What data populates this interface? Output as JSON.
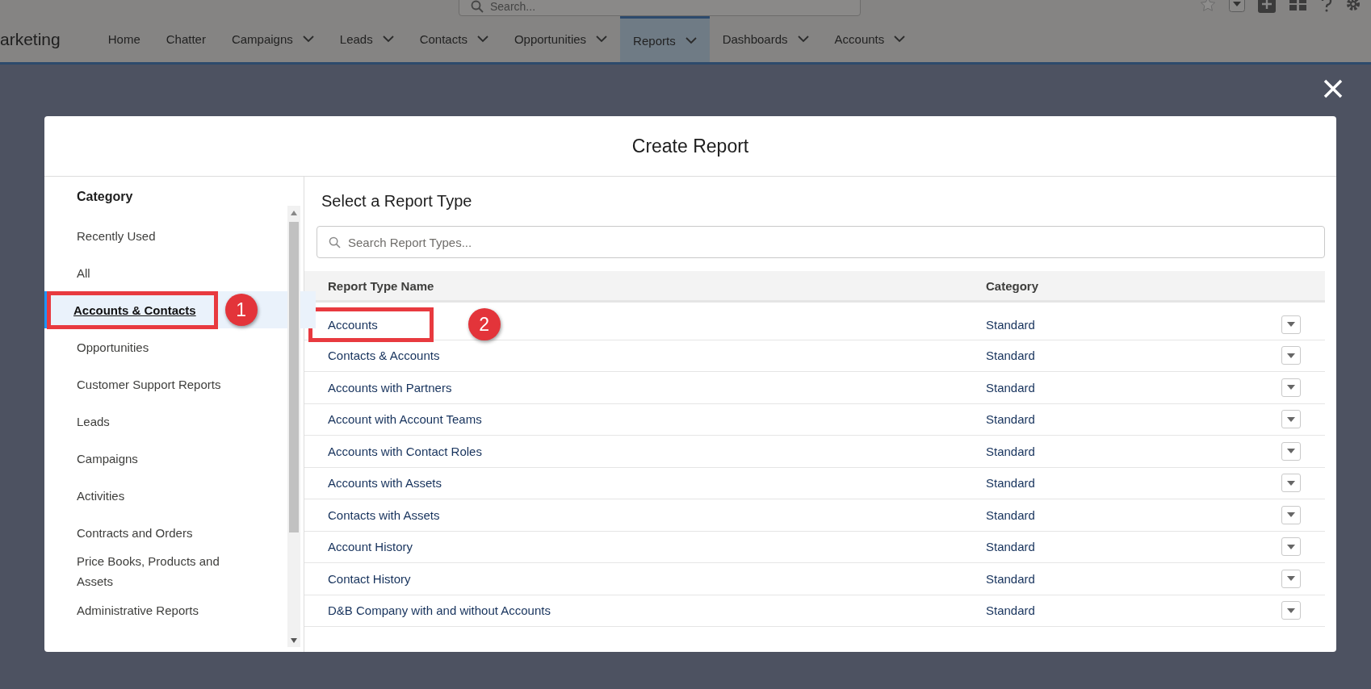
{
  "app": {
    "name": "arketing",
    "search_placeholder": "Search..."
  },
  "nav": [
    {
      "label": "Home",
      "has_menu": false,
      "selected": false
    },
    {
      "label": "Chatter",
      "has_menu": false,
      "selected": false
    },
    {
      "label": "Campaigns",
      "has_menu": true,
      "selected": false
    },
    {
      "label": "Leads",
      "has_menu": true,
      "selected": false
    },
    {
      "label": "Contacts",
      "has_menu": true,
      "selected": false
    },
    {
      "label": "Opportunities",
      "has_menu": true,
      "selected": false
    },
    {
      "label": "Reports",
      "has_menu": true,
      "selected": true
    },
    {
      "label": "Dashboards",
      "has_menu": true,
      "selected": false
    },
    {
      "label": "Accounts",
      "has_menu": true,
      "selected": false
    }
  ],
  "modal": {
    "title": "Create Report",
    "sidebar": {
      "heading": "Category",
      "items": [
        {
          "label": "Recently Used",
          "selected": false
        },
        {
          "label": "All",
          "selected": false
        },
        {
          "label": "Accounts & Contacts",
          "selected": true,
          "callout": "1"
        },
        {
          "label": "Opportunities",
          "selected": false
        },
        {
          "label": "Customer Support Reports",
          "selected": false
        },
        {
          "label": "Leads",
          "selected": false
        },
        {
          "label": "Campaigns",
          "selected": false
        },
        {
          "label": "Activities",
          "selected": false
        },
        {
          "label": "Contracts and Orders",
          "selected": false
        },
        {
          "label": "Price Books, Products and Assets",
          "selected": false
        },
        {
          "label": "Administrative Reports",
          "selected": false
        }
      ]
    },
    "main": {
      "heading": "Select a Report Type",
      "search_placeholder": "Search Report Types...",
      "columns": [
        "Report Type Name",
        "Category"
      ],
      "rows": [
        {
          "name": "Accounts",
          "category": "Standard",
          "callout": "2"
        },
        {
          "name": "Contacts & Accounts",
          "category": "Standard"
        },
        {
          "name": "Accounts with Partners",
          "category": "Standard"
        },
        {
          "name": "Account with Account Teams",
          "category": "Standard"
        },
        {
          "name": "Accounts with Contact Roles",
          "category": "Standard"
        },
        {
          "name": "Accounts with Assets",
          "category": "Standard"
        },
        {
          "name": "Contacts with Assets",
          "category": "Standard"
        },
        {
          "name": "Account History",
          "category": "Standard"
        },
        {
          "name": "Contact History",
          "category": "Standard"
        },
        {
          "name": "D&B Company with and without Accounts",
          "category": "Standard"
        }
      ]
    }
  }
}
